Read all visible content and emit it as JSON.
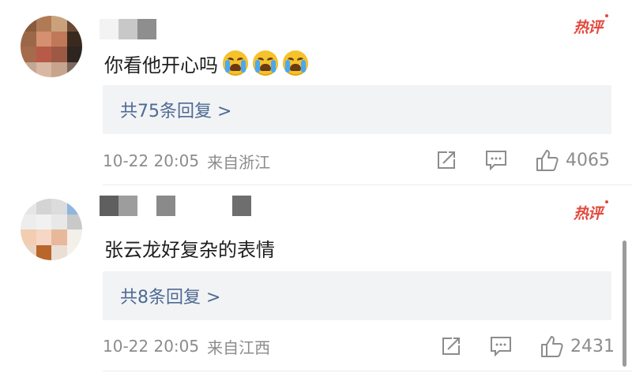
{
  "comments": [
    {
      "text": "你看他开心吗",
      "emoji_count": 3,
      "emoji_name": "crying-face-icon",
      "hot_badge": "热评",
      "reply_summary": "共75条回复 >",
      "timestamp": "10-22 20:05",
      "location": "来自浙江",
      "likes": "4065"
    },
    {
      "text": "张云龙好复杂的表情",
      "hot_badge": "热评",
      "reply_summary": "共8条回复 >",
      "timestamp": "10-22 20:05",
      "location": "来自江西",
      "likes": "2431"
    }
  ],
  "colors": {
    "hot_badge": "#e34a3f",
    "reply_link": "#4d6a93",
    "reply_bg": "#f2f3f5",
    "meta_gray": "#8c8c8c"
  },
  "icons": [
    "share-icon",
    "comment-icon",
    "like-icon"
  ]
}
